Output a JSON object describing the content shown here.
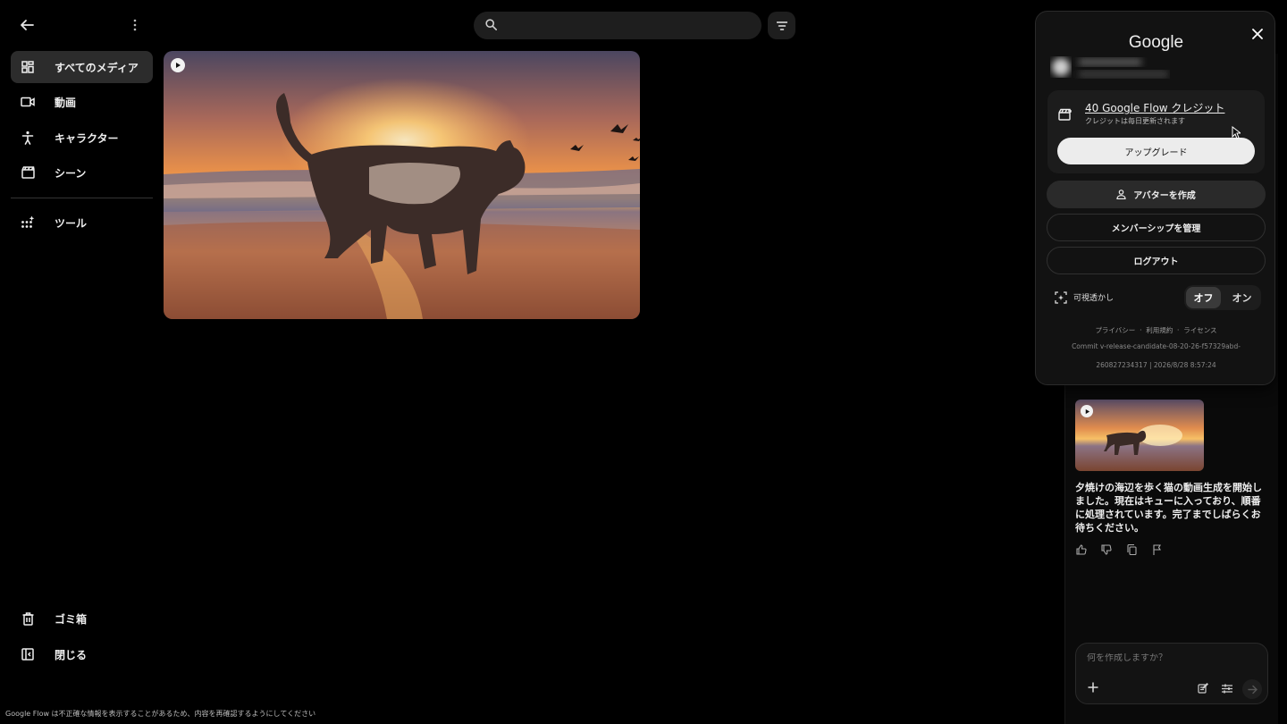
{
  "search": {
    "placeholder": ""
  },
  "sidebar": {
    "items": [
      {
        "label": "すべてのメディア",
        "icon": "grid-icon"
      },
      {
        "label": "動画",
        "icon": "video-camera-icon"
      },
      {
        "label": "キャラクター",
        "icon": "person-icon"
      },
      {
        "label": "シーン",
        "icon": "clapperboard-icon"
      },
      {
        "label": "ツール",
        "icon": "tools-grid-icon"
      }
    ],
    "bottom": [
      {
        "label": "ゴミ箱",
        "icon": "trash-icon"
      },
      {
        "label": "閉じる",
        "icon": "collapse-sidebar-icon"
      }
    ]
  },
  "disclaimer": "Google Flow は不正確な情報を表示することがあるため、内容を再確認するようにしてください",
  "account": {
    "brand": "Google",
    "credits_title": "40 Google Flow クレジット",
    "credits_sub": "クレジットは毎日更新されます",
    "upgrade_label": "アップグレード",
    "avatar_label": "アバターを作成",
    "membership_label": "メンバーシップを管理",
    "logout_label": "ログアウト",
    "watermark_label": "可視透かし",
    "watermark_off": "オフ",
    "watermark_on": "オン",
    "watermark_state": "off",
    "privacy": "プライバシー",
    "terms": "利用規約",
    "license": "ライセンス",
    "sep": "·",
    "commit_line1": "Commit v-release-candidate-08-20-26-f57329abd-",
    "commit_line2": "260827234317 | 2026/8/28 8:57:24"
  },
  "chat": {
    "message": "夕焼けの海辺を歩く猫の動画生成を開始しました。現在はキューに入っており、順番に処理されています。完了までしばらくお待ちください。",
    "composer_placeholder": "何を作成しますか？"
  }
}
